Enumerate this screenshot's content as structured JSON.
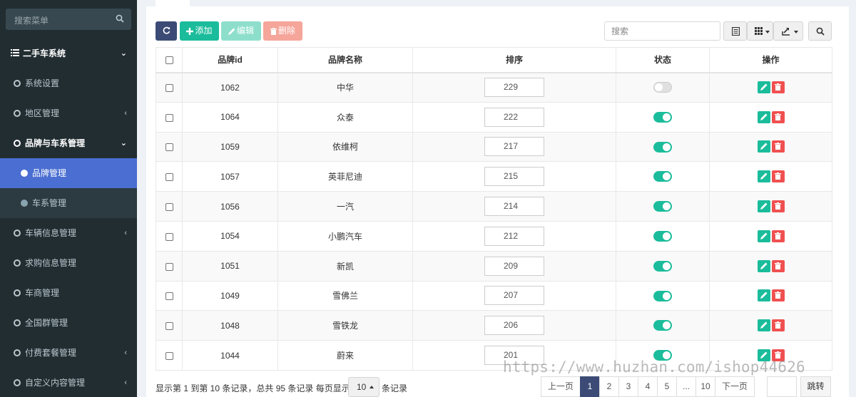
{
  "sidebar": {
    "search_placeholder": "搜索菜单",
    "items": [
      {
        "label": "二手车系统",
        "kind": "top",
        "chevron": "⌄"
      },
      {
        "label": "系统设置",
        "kind": "item",
        "chevron": ""
      },
      {
        "label": "地区管理",
        "kind": "item",
        "chevron": "‹"
      },
      {
        "label": "品牌与车系管理",
        "kind": "group",
        "chevron": "⌄"
      },
      {
        "label": "品牌管理",
        "kind": "active",
        "chevron": ""
      },
      {
        "label": "车系管理",
        "kind": "sub",
        "chevron": ""
      },
      {
        "label": "车辆信息管理",
        "kind": "item",
        "chevron": "‹"
      },
      {
        "label": "求购信息管理",
        "kind": "item",
        "chevron": ""
      },
      {
        "label": "车商管理",
        "kind": "item",
        "chevron": ""
      },
      {
        "label": "全国群管理",
        "kind": "item",
        "chevron": ""
      },
      {
        "label": "付费套餐管理",
        "kind": "item",
        "chevron": "‹"
      },
      {
        "label": "自定义内容管理",
        "kind": "item",
        "chevron": "‹"
      }
    ]
  },
  "toolbar": {
    "add_label": "添加",
    "edit_label": "编辑",
    "delete_label": "删除",
    "search_placeholder": "搜索"
  },
  "table": {
    "headers": {
      "id": "品牌id",
      "name": "品牌名称",
      "order": "排序",
      "status": "状态",
      "actions": "操作"
    },
    "rows": [
      {
        "id": "1062",
        "name": "中华",
        "order": "229",
        "enabled": false
      },
      {
        "id": "1064",
        "name": "众泰",
        "order": "222",
        "enabled": true
      },
      {
        "id": "1059",
        "name": "依维柯",
        "order": "217",
        "enabled": true
      },
      {
        "id": "1057",
        "name": "英菲尼迪",
        "order": "215",
        "enabled": true
      },
      {
        "id": "1056",
        "name": "一汽",
        "order": "214",
        "enabled": true
      },
      {
        "id": "1054",
        "name": "小鹏汽车",
        "order": "212",
        "enabled": true
      },
      {
        "id": "1051",
        "name": "新凯",
        "order": "209",
        "enabled": true
      },
      {
        "id": "1049",
        "name": "雪佛兰",
        "order": "207",
        "enabled": true
      },
      {
        "id": "1048",
        "name": "雪铁龙",
        "order": "206",
        "enabled": true
      },
      {
        "id": "1044",
        "name": "蔚来",
        "order": "201",
        "enabled": true
      }
    ]
  },
  "footer": {
    "info_text": "显示第 1 到第 10 条记录，总共 95 条记录 每页显示",
    "page_size": "10",
    "suffix_text": "条记录",
    "prev_label": "上一页",
    "next_label": "下一页",
    "pages": [
      "1",
      "2",
      "3",
      "4",
      "5",
      "...",
      "10"
    ],
    "current_page": "1",
    "jump_label": "跳转"
  },
  "watermark": "https://www.huzhan.com/ishop44626",
  "colors": {
    "sidebar_bg": "#222d32",
    "sidebar_active": "#4a6ed1",
    "primary_dark": "#3c4b76",
    "success": "#1bbc9b",
    "danger": "#f05050"
  }
}
